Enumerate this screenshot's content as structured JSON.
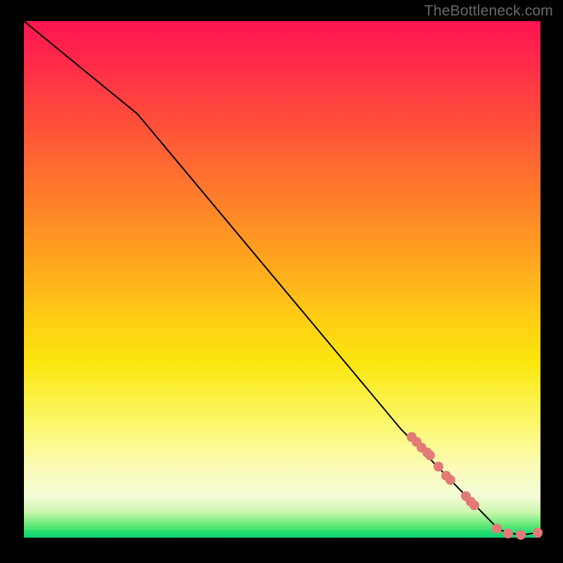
{
  "watermark": "TheBottleneck.com",
  "chart_data": {
    "type": "line",
    "title": "",
    "xlabel": "",
    "ylabel": "",
    "xlim": [
      0,
      100
    ],
    "ylim": [
      0,
      100
    ],
    "curve": {
      "description": "Descending line with slight initial slope break then near-linear drop, flattening at the bottom right",
      "points": [
        {
          "x": 0,
          "y": 100
        },
        {
          "x": 22,
          "y": 82
        },
        {
          "x": 73,
          "y": 21
        },
        {
          "x": 92,
          "y": 1.5
        },
        {
          "x": 96,
          "y": 0.5
        },
        {
          "x": 100,
          "y": 1
        }
      ]
    },
    "markers": {
      "color": "#e47a78",
      "radius_px": 7,
      "points": [
        {
          "x": 75.0,
          "y": 19.5
        },
        {
          "x": 76.0,
          "y": 18.5
        },
        {
          "x": 77.0,
          "y": 17.5
        },
        {
          "x": 78.0,
          "y": 16.5
        },
        {
          "x": 78.6,
          "y": 16.0
        },
        {
          "x": 80.2,
          "y": 13.8
        },
        {
          "x": 81.8,
          "y": 12.0
        },
        {
          "x": 82.6,
          "y": 11.2
        },
        {
          "x": 85.5,
          "y": 8.0
        },
        {
          "x": 86.5,
          "y": 7.0
        },
        {
          "x": 87.2,
          "y": 6.2
        },
        {
          "x": 91.5,
          "y": 1.8
        },
        {
          "x": 93.8,
          "y": 0.8
        },
        {
          "x": 96.2,
          "y": 0.5
        },
        {
          "x": 99.5,
          "y": 1.0
        }
      ]
    }
  }
}
